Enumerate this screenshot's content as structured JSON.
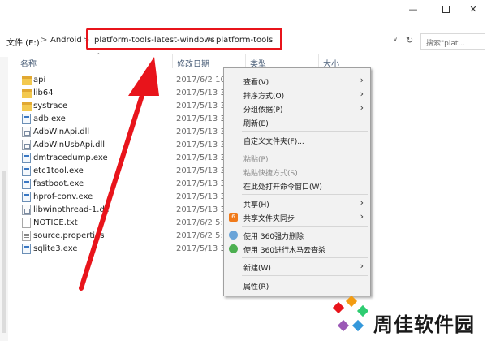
{
  "breadcrumb": {
    "items": [
      "文件 (E:)",
      "Android",
      "platform-tools-latest-windows",
      "platform-tools"
    ],
    "separator": ">"
  },
  "search": {
    "placeholder": "搜索\"plat..."
  },
  "columns": [
    "名称",
    "修改日期",
    "类型",
    "大小"
  ],
  "files": [
    {
      "name": "api",
      "date": "2017/6/2 10:",
      "kind": "folder"
    },
    {
      "name": "lib64",
      "date": "2017/5/13 3:",
      "kind": "folder"
    },
    {
      "name": "systrace",
      "date": "2017/5/13 3:",
      "kind": "folder"
    },
    {
      "name": "adb.exe",
      "date": "2017/5/13 3:",
      "kind": "exe"
    },
    {
      "name": "AdbWinApi.dll",
      "date": "2017/5/13 3:",
      "kind": "dll"
    },
    {
      "name": "AdbWinUsbApi.dll",
      "date": "2017/5/13 3:",
      "kind": "dll"
    },
    {
      "name": "dmtracedump.exe",
      "date": "2017/5/13 3:",
      "kind": "exe"
    },
    {
      "name": "etc1tool.exe",
      "date": "2017/5/13 3:",
      "kind": "exe"
    },
    {
      "name": "fastboot.exe",
      "date": "2017/5/13 3:",
      "kind": "exe"
    },
    {
      "name": "hprof-conv.exe",
      "date": "2017/5/13 3:",
      "kind": "exe"
    },
    {
      "name": "libwinpthread-1.dll",
      "date": "2017/5/13 3:",
      "kind": "dll"
    },
    {
      "name": "NOTICE.txt",
      "date": "2017/6/2 5:",
      "kind": "file"
    },
    {
      "name": "source.properties",
      "date": "2017/6/2 5:",
      "kind": "prop"
    },
    {
      "name": "sqlite3.exe",
      "date": "2017/5/13 3:",
      "kind": "exe"
    }
  ],
  "context_menu": {
    "view": "查看(V)",
    "sort": "排序方式(O)",
    "group": "分组依据(P)",
    "refresh": "刷新(E)",
    "customize": "自定义文件夹(F)...",
    "paste": "粘贴(P)",
    "paste_shortcut": "粘贴快捷方式(S)",
    "open_cmd": "在此处打开命令窗口(W)",
    "share": "共享(H)",
    "share_sync": "共享文件夹同步",
    "force_delete": "使用 360强力删除",
    "trojan_scan": "使用 360进行木马云查杀",
    "new": "新建(W)",
    "properties": "属性(R)"
  },
  "watermark": {
    "text": "周佳软件园"
  },
  "colors": {
    "highlight": "#e8141b",
    "header_text": "#4c607a",
    "menu_bg": "#f2f2f2"
  }
}
